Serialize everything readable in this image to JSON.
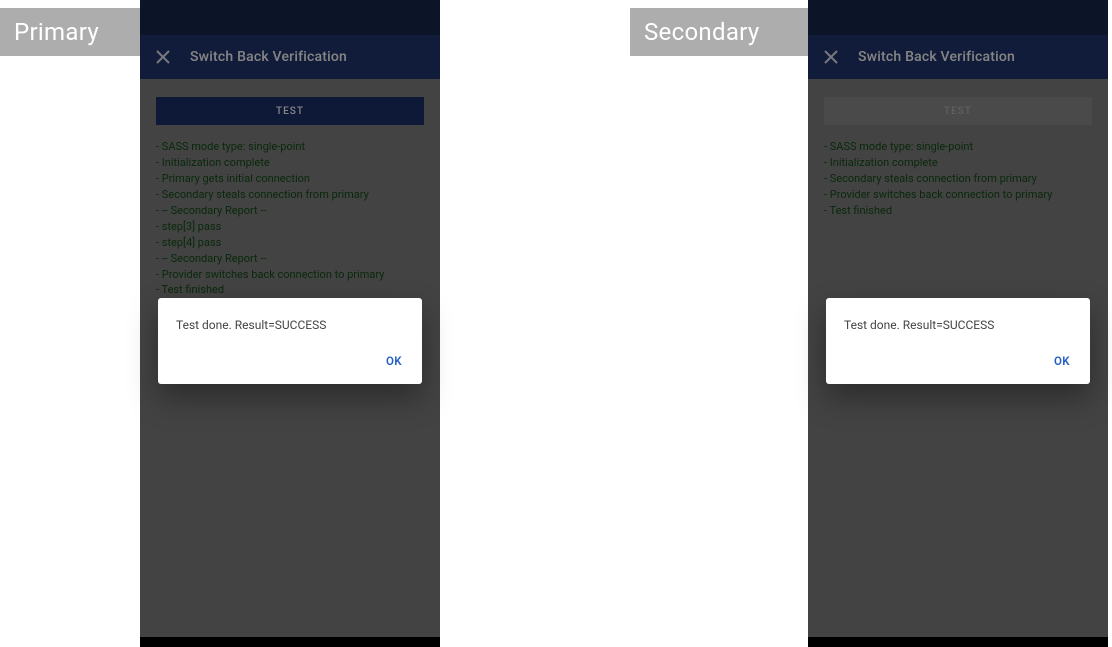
{
  "primary": {
    "device_label": "Primary",
    "app_bar_title": "Switch Back Verification",
    "test_button_label": "TEST",
    "test_button_disabled": false,
    "log_lines": [
      "- SASS mode type: single-point",
      "- Initialization complete",
      "- Primary gets initial connection",
      "- Secondary steals connection from primary",
      "- -- Secondary Report --",
      "- step[3] pass",
      "- step[4] pass",
      "- -- Secondary Report --",
      "- Provider switches back connection to primary",
      "- Test finished"
    ],
    "dialog": {
      "message": "Test done. Result=SUCCESS",
      "ok_label": "OK"
    }
  },
  "secondary": {
    "device_label": "Secondary",
    "app_bar_title": "Switch Back Verification",
    "test_button_label": "TEST",
    "test_button_disabled": true,
    "log_lines": [
      "- SASS mode type: single-point",
      "- Initialization complete",
      "- Secondary steals connection from primary",
      "- Provider switches back connection to primary",
      "- Test finished"
    ],
    "dialog": {
      "message": "Test done. Result=SUCCESS",
      "ok_label": "OK"
    }
  }
}
